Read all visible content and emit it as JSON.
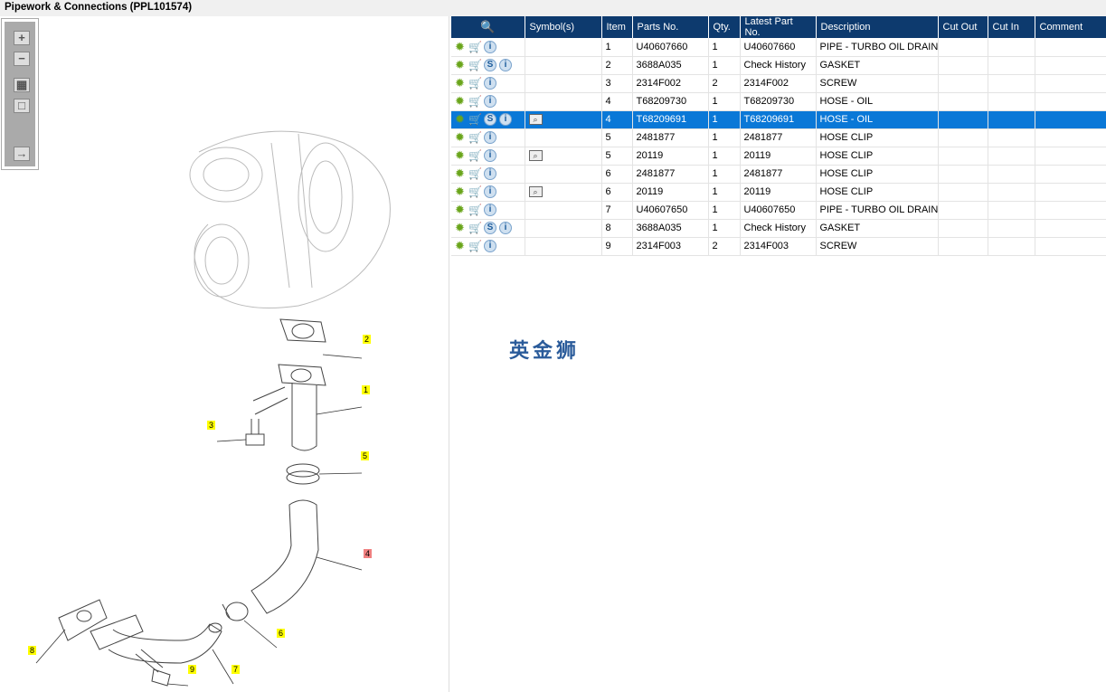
{
  "title": "Pipework & Connections (PPL101574)",
  "toolbar": {
    "zoom_in": "+",
    "zoom_out": "−",
    "fit": "▦",
    "actual": "□",
    "export": "→"
  },
  "callouts": [
    "2",
    "1",
    "3",
    "5",
    "4",
    "6",
    "8",
    "9",
    "7"
  ],
  "watermark": "英金狮",
  "table": {
    "headers": [
      "Symbol(s)",
      "Item",
      "Parts No.",
      "Qty.",
      "Latest Part No.",
      "Description",
      "Cut Out",
      "Cut In",
      "Comment"
    ],
    "rows": [
      {
        "item": "1",
        "part": "U40607660",
        "qty": "1",
        "latest": "U40607660",
        "desc": "PIPE - TURBO OIL DRAIN",
        "s": false,
        "book": false
      },
      {
        "item": "2",
        "part": "3688A035",
        "qty": "1",
        "latest": "Check History",
        "desc": "GASKET",
        "s": true,
        "book": false
      },
      {
        "item": "3",
        "part": "2314F002",
        "qty": "2",
        "latest": "2314F002",
        "desc": "SCREW",
        "s": false,
        "book": false
      },
      {
        "item": "4",
        "part": "T68209730",
        "qty": "1",
        "latest": "T68209730",
        "desc": "HOSE - OIL",
        "s": false,
        "book": false
      },
      {
        "item": "4",
        "part": "T68209691",
        "qty": "1",
        "latest": "T68209691",
        "desc": "HOSE - OIL",
        "s": true,
        "book": true,
        "selected": true
      },
      {
        "item": "5",
        "part": "2481877",
        "qty": "1",
        "latest": "2481877",
        "desc": "HOSE CLIP",
        "s": false,
        "book": false
      },
      {
        "item": "5",
        "part": "20119",
        "qty": "1",
        "latest": "20119",
        "desc": "HOSE CLIP",
        "s": false,
        "book": true
      },
      {
        "item": "6",
        "part": "2481877",
        "qty": "1",
        "latest": "2481877",
        "desc": "HOSE CLIP",
        "s": false,
        "book": false
      },
      {
        "item": "6",
        "part": "20119",
        "qty": "1",
        "latest": "20119",
        "desc": "HOSE CLIP",
        "s": false,
        "book": true
      },
      {
        "item": "7",
        "part": "U40607650",
        "qty": "1",
        "latest": "U40607650",
        "desc": "PIPE - TURBO OIL DRAIN",
        "s": false,
        "book": false
      },
      {
        "item": "8",
        "part": "3688A035",
        "qty": "1",
        "latest": "Check History",
        "desc": "GASKET",
        "s": true,
        "book": false
      },
      {
        "item": "9",
        "part": "2314F003",
        "qty": "2",
        "latest": "2314F003",
        "desc": "SCREW",
        "s": false,
        "book": false
      }
    ]
  }
}
